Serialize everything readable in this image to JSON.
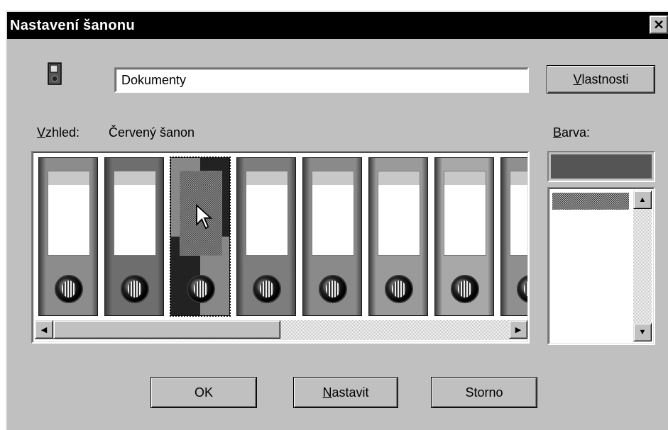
{
  "window": {
    "title": "Nastavení šanonu",
    "close_glyph": "✕"
  },
  "name_field": {
    "value": "Dokumenty",
    "icon": "binder-icon"
  },
  "properties_button": {
    "label_u": "V",
    "label_rest": "lastnosti"
  },
  "appearance": {
    "label_u": "V",
    "label_rest": "zhled:",
    "selected_name": "Červený šanon",
    "binders": [
      {
        "color": "#8c8c8c"
      },
      {
        "color": "#6e6e6e"
      },
      {
        "color": "#3a3a3a",
        "selected": true
      },
      {
        "color": "#7d7d7d"
      },
      {
        "color": "#8a8a8a"
      },
      {
        "color": "#9a9a9a"
      },
      {
        "color": "#a8a8a8"
      },
      {
        "color": "#8f8f8f"
      }
    ],
    "scroll_left_glyph": "◀",
    "scroll_right_glyph": "▶"
  },
  "color": {
    "label_u": "B",
    "label_rest": "arva:",
    "current": "#555555",
    "scroll_up_glyph": "▲",
    "scroll_down_glyph": "▼"
  },
  "buttons": {
    "ok": "OK",
    "apply_u": "N",
    "apply_rest": "astavit",
    "cancel": "Storno"
  }
}
